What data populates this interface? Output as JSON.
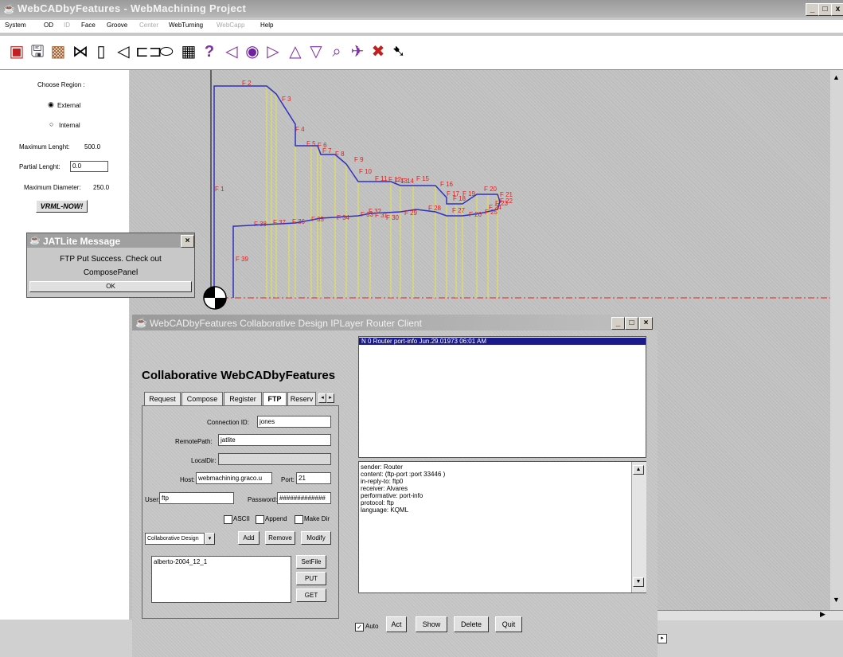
{
  "window": {
    "title": "WebCADbyFeatures - WebMachining Project",
    "controls": [
      "_",
      "□",
      "x"
    ]
  },
  "menu": [
    "System",
    "OD",
    "ID",
    "Face",
    "Groove",
    "Center",
    "WebTurning",
    "WebCapp",
    "Help"
  ],
  "left_panel": {
    "choose_region": "Choose Region :",
    "external": "External",
    "internal": "Internal",
    "max_length_label": "Maximum Lenght:",
    "max_length_value": "500.0",
    "partial_length_label": "Partial Lenght:",
    "partial_length_value": "0.0",
    "max_diameter_label": "Maximum Diameter:",
    "max_diameter_value": "250.0",
    "vrml_button": "VRML-NOW!"
  },
  "jatlite": {
    "title": "JATLite Message",
    "line1": "FTP Put Success. Check out",
    "line2": "ComposePanel",
    "ok": "OK"
  },
  "features": {
    "top": [
      "F 2",
      "F 3",
      "F 4",
      "F 5",
      "F 6",
      "F 7",
      "F 8",
      "F 9",
      "F 10",
      "F 11",
      "F 12",
      "F 13",
      "F 14",
      "F 15",
      "F 16",
      "F 17",
      "F 18",
      "F 19",
      "F 20",
      "F 21",
      "F 22"
    ],
    "bottom": [
      "F 38",
      "F 37",
      "F 36",
      "F 35",
      "F 34",
      "F 33",
      "F 32",
      "F 31",
      "F 30",
      "F 29",
      "F 28",
      "F 27",
      "F 26",
      "F 25",
      "F 24",
      "F 23"
    ],
    "f1": "F 1",
    "f39": "F 39"
  },
  "client": {
    "title": "WebCADbyFeatures Collaborative Design IPLayer Router Client",
    "heading": "Collaborative WebCADbyFeatures",
    "tabs": [
      "Request",
      "Compose",
      "Register",
      "FTP",
      "Reserv"
    ],
    "connection_id_label": "Connection ID:",
    "connection_id": "jones",
    "remote_path_label": "RemotePath:",
    "remote_path": "jatlite",
    "local_dir_label": "LocalDir:",
    "local_dir": "",
    "host_label": "Host:",
    "host": "webmachining.graco.u",
    "port_label": "Port:",
    "port": "21",
    "user_label": "User:",
    "user": "ftp",
    "password_label": "Password:",
    "password": "#############",
    "ascii": "ASCII",
    "append": "Append",
    "make_dir": "Make Dir",
    "select_value": "Collaborative Design",
    "add": "Add",
    "remove": "Remove",
    "modify": "Modify",
    "files": [
      "alberto-2004_12_1"
    ],
    "setfile": "SetFile",
    "put": "PUT",
    "get": "GET",
    "router_list": [
      "N   0   Router   port-info   Jun.29.01973 06:01 AM"
    ],
    "message_lines": [
      "sender: Router",
      "content: (ftp-port :port 33446 )",
      "in-reply-to: ftp0",
      "receiver: Alvares",
      "performative: port-info",
      "protocol: ftp",
      "language: KQML"
    ],
    "auto": "Auto",
    "act": "Act",
    "show": "Show",
    "delete": "Delete",
    "quit": "Quit"
  }
}
